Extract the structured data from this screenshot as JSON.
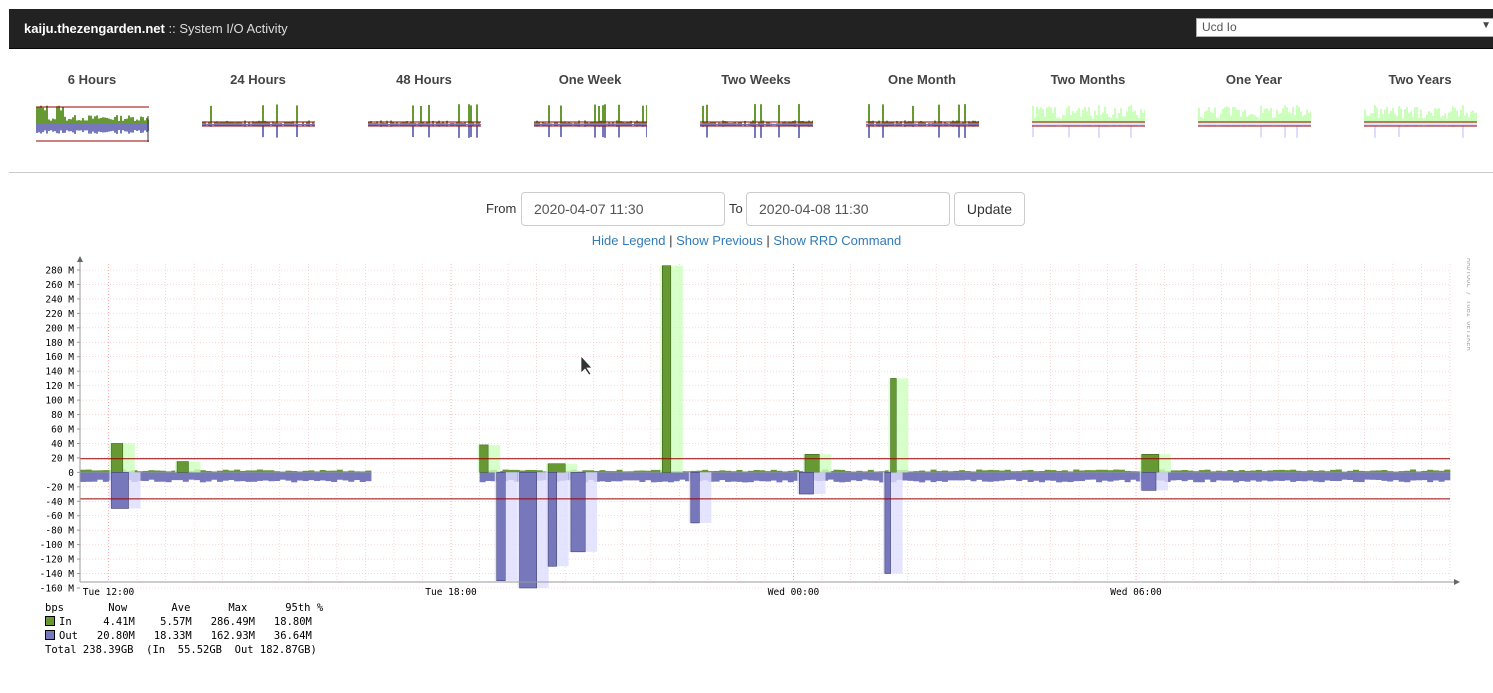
{
  "header": {
    "host": "kaiju.thezengarden.net",
    "separator": " :: ",
    "page_title": "System I/O Activity",
    "graph_select_value": "Ucd Io"
  },
  "thumbnails": [
    {
      "label": "6 Hours"
    },
    {
      "label": "24 Hours"
    },
    {
      "label": "48 Hours"
    },
    {
      "label": "One Week"
    },
    {
      "label": "Two Weeks"
    },
    {
      "label": "One Month"
    },
    {
      "label": "Two Months"
    },
    {
      "label": "One Year"
    },
    {
      "label": "Two Years"
    }
  ],
  "range": {
    "from_label": "From",
    "from_value": "2020-04-07 11:30",
    "to_label": "To",
    "to_value": "2020-04-08 11:30",
    "update_label": "Update"
  },
  "links": {
    "hide_legend": "Hide Legend",
    "sep": " | ",
    "show_previous": "Show Previous",
    "show_rrd": "Show RRD Command"
  },
  "chart_data": {
    "type": "area",
    "watermark": "RRDTOOL / TOBI OETIKER",
    "y_ticks": [
      "280 M",
      "260 M",
      "240 M",
      "220 M",
      "200 M",
      "180 M",
      "160 M",
      "140 M",
      "120 M",
      "100 M",
      "80 M",
      "60 M",
      "40 M",
      "20 M",
      "0",
      "-20 M",
      "-40 M",
      "-60 M",
      "-80 M",
      "-100 M",
      "-120 M",
      "-140 M",
      "-160 M"
    ],
    "ylim": [
      -160,
      280
    ],
    "x_ticks": [
      {
        "label": "Tue 12:00",
        "hour": 0.5
      },
      {
        "label": "Tue 18:00",
        "hour": 6.5
      },
      {
        "label": "Wed 00:00",
        "hour": 12.5
      },
      {
        "label": "Wed 06:00",
        "hour": 18.5
      }
    ],
    "x_range_hours": [
      0,
      24
    ],
    "percentile_95": {
      "in": 18.8,
      "out": -36.64
    },
    "colors": {
      "in": "#669933",
      "in_max": "#ccffbb",
      "out": "#7777bb",
      "out_max": "#ddddff",
      "grid_major": "#ff9999",
      "pct": "#990000"
    },
    "gap_hours": [
      5.0,
      6.9
    ],
    "in_spikes": [
      {
        "hour": 0.55,
        "avg": 40,
        "max": 40,
        "width": 0.2
      },
      {
        "hour": 1.7,
        "avg": 15,
        "max": 15,
        "width": 0.2
      },
      {
        "hour": 7.0,
        "avg": 38,
        "max": 38,
        "width": 0.15
      },
      {
        "hour": 8.2,
        "avg": 12,
        "max": 12,
        "width": 0.3
      },
      {
        "hour": 10.2,
        "avg": 286,
        "max": 286,
        "width": 0.15
      },
      {
        "hour": 12.7,
        "avg": 25,
        "max": 25,
        "width": 0.25
      },
      {
        "hour": 14.2,
        "avg": 130,
        "max": 130,
        "width": 0.1
      },
      {
        "hour": 18.6,
        "avg": 25,
        "max": 25,
        "width": 0.3
      }
    ],
    "out_spikes": [
      {
        "hour": 0.55,
        "avg": -50,
        "max": -50,
        "width": 0.3
      },
      {
        "hour": 7.3,
        "avg": -150,
        "max": -150,
        "width": 0.15
      },
      {
        "hour": 7.7,
        "avg": -160,
        "max": -160,
        "width": 0.3
      },
      {
        "hour": 8.2,
        "avg": -130,
        "max": -130,
        "width": 0.15
      },
      {
        "hour": 8.6,
        "avg": -110,
        "max": -110,
        "width": 0.25
      },
      {
        "hour": 10.7,
        "avg": -70,
        "max": -70,
        "width": 0.15
      },
      {
        "hour": 12.6,
        "avg": -30,
        "max": -30,
        "width": 0.25
      },
      {
        "hour": 14.1,
        "avg": -140,
        "max": -140,
        "width": 0.1
      },
      {
        "hour": 18.6,
        "avg": -25,
        "max": -25,
        "width": 0.25
      }
    ],
    "legend": {
      "unit": "bps",
      "headers": [
        "Now",
        "Ave",
        "Max",
        "95th %"
      ],
      "series": [
        {
          "name": "In",
          "values": [
            "4.41M",
            "5.57M",
            "286.49M",
            "18.80M"
          ]
        },
        {
          "name": "Out",
          "values": [
            "20.80M",
            "18.33M",
            "162.93M",
            "36.64M"
          ]
        }
      ],
      "total": "Total 238.39GB  (In  55.52GB  Out 182.87GB)"
    }
  }
}
